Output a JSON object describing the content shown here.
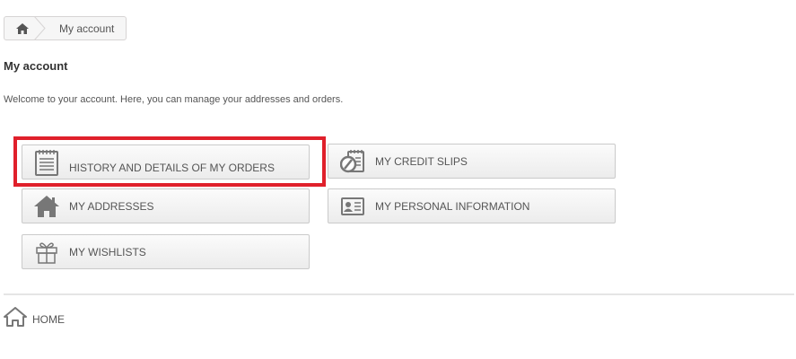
{
  "breadcrumb": {
    "current": "My account"
  },
  "page": {
    "title": "My account",
    "welcome": "Welcome to your account. Here, you can manage your addresses and orders."
  },
  "buttons": {
    "orders": {
      "label": "HISTORY AND DETAILS OF MY ORDERS",
      "icon": "order-list-icon"
    },
    "credit_slips": {
      "label": "MY CREDIT SLIPS",
      "icon": "credit-slip-icon"
    },
    "addresses": {
      "label": "MY ADDRESSES",
      "icon": "home-icon"
    },
    "personal_info": {
      "label": "MY PERSONAL INFORMATION",
      "icon": "id-card-icon"
    },
    "wishlists": {
      "label": "MY WISHLISTS",
      "icon": "gift-icon"
    }
  },
  "footer": {
    "home_label": "HOME"
  },
  "colors": {
    "highlight": "#e0202b",
    "icon": "#777777"
  }
}
